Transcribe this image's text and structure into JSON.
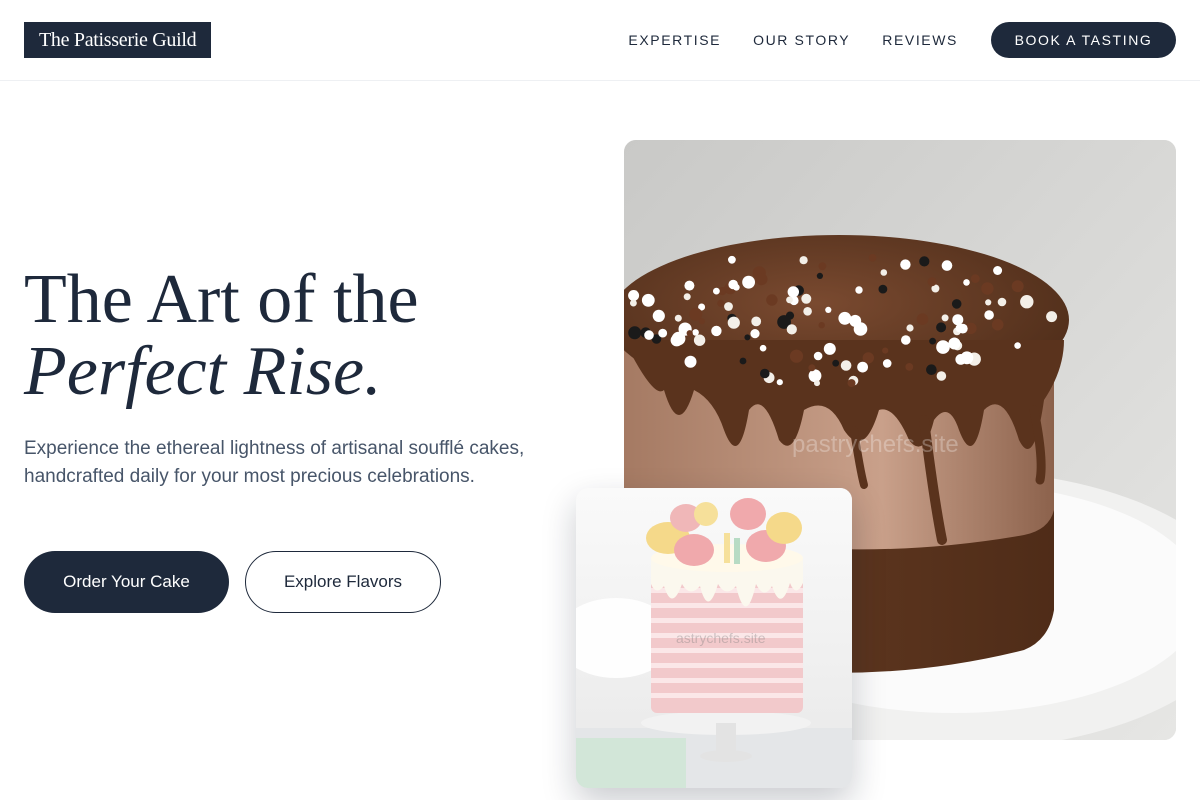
{
  "brand": {
    "name": "The Patisserie Guild"
  },
  "nav": {
    "links": [
      "EXPERTISE",
      "OUR STORY",
      "REVIEWS"
    ],
    "cta": "BOOK A TASTING"
  },
  "hero": {
    "title_line1": "The Art of the",
    "title_line2": "Perfect Rise.",
    "description": "Experience the ethereal lightness of artisanal soufflé cakes, handcrafted daily for your most precious celebrations.",
    "primary_button": "Order Your Cake",
    "secondary_button": "Explore Flavors"
  },
  "images": {
    "main_watermark": "pastrychefs.site",
    "card_watermark": "astrychefs.site"
  },
  "colors": {
    "primary": "#1e293b",
    "text_muted": "#475569",
    "background": "#ffffff"
  }
}
